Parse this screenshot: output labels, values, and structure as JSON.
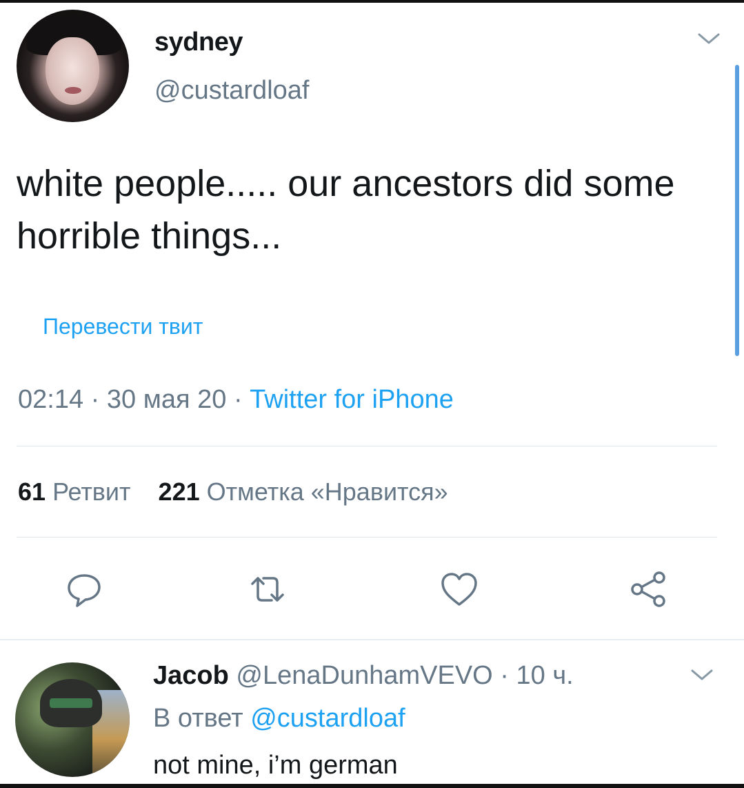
{
  "tweet": {
    "author_name": "sydney",
    "author_handle": "@custardloaf",
    "text": "white people..... our ancestors did some horrible things...",
    "translate_link": "Перевести твит",
    "time": "02:14",
    "date": "30 мая 20",
    "meta_sep": "·",
    "source": "Twitter for iPhone",
    "retweet_count": "61",
    "retweet_label": "Ретвит",
    "like_count": "221",
    "like_label": "Отметка «Нравится»"
  },
  "actions": {
    "icons": [
      "reply-icon",
      "retweet-icon",
      "like-icon",
      "share-icon"
    ]
  },
  "reply": {
    "author_name": "Jacob",
    "author_handle": "@LenaDunhamVEVO",
    "sep": "·",
    "time_ago": "10 ч.",
    "reply_prefix": "В ответ",
    "reply_to": "@custardloaf",
    "text": "not mine, i’m german"
  },
  "colors": {
    "accent": "#1da1f2",
    "secondary_text": "#657786",
    "primary_text": "#14171a",
    "scrollbar": "#5a9fe0"
  }
}
